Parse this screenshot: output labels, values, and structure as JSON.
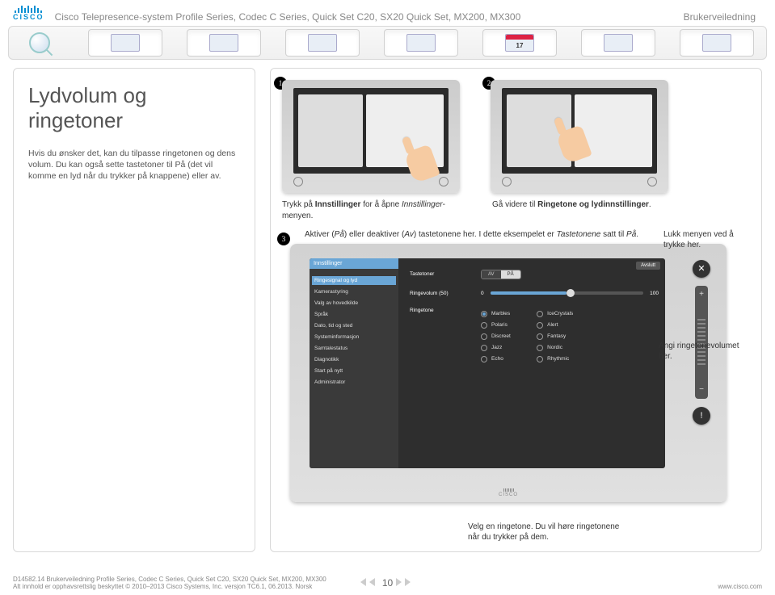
{
  "header": {
    "brand": "CISCO",
    "product_line": "Cisco Telepresence-system Profile Series, Codec C Series, Quick Set C20, SX20 Quick Set, MX200, MX300",
    "guide_label": "Brukerveiledning"
  },
  "nav": {
    "calendar_day": "17"
  },
  "left": {
    "title": "Lydvolum og ringetoner",
    "para1": "Hvis du ønsker det, kan du tilpasse ringetonen og dens volum. Du kan også sette tastetoner til På (det vil komme en lyd når du trykker på knappene) eller av.",
    "em_pa": "På"
  },
  "steps": {
    "s1_a": "Trykk på ",
    "s1_b": "Innstillinger",
    "s1_c": " for å åpne ",
    "s1_d": "Innstillinger",
    "s1_e": "-menyen.",
    "s2_a": "Gå videre til ",
    "s2_b": "Ringetone og lydinnstillinger",
    "s2_c": ".",
    "s3_a": "Aktiver (",
    "s3_pa": "På",
    "s3_b": ") eller deaktiver (",
    "s3_av": "Av",
    "s3_c": ") tastetonene her. I dette eksempelet er ",
    "s3_d": "Tastetonene",
    "s3_e": " satt til ",
    "s3_f": "På",
    "s3_g": "."
  },
  "annotations": {
    "close_menu": "Lukk menyen ved å trykke her.",
    "set_volume": "Angi ringetonevolumet her.",
    "pick_ringtone": "Velg en ringetone. Du vil høre ringetonene når du trykker på dem."
  },
  "settings_panel": {
    "header": "Innstillinger",
    "active_item": "Ringesignal og lyd",
    "close_btn": "Avslutt",
    "menu": [
      "Ringesignal og lyd",
      "Kamerastyring",
      "Valg av hovedkilde",
      "Språk",
      "Dato, tid og sted",
      "Systeminformasjon",
      "Samtalestatus",
      "Diagnotikk",
      "Start på nytt",
      "Administrator"
    ],
    "keytones_label": "Tastetoner",
    "toggle_off": "AV",
    "toggle_on": "PÅ",
    "volume_label": "Ringevolum (50)",
    "volume_min": "0",
    "volume_max": "100",
    "ringtone_label": "Ringetone",
    "ringtones": [
      {
        "name": "Marbles",
        "selected": true
      },
      {
        "name": "IceCrystals",
        "selected": false
      },
      {
        "name": "Polaris",
        "selected": false
      },
      {
        "name": "Alert",
        "selected": false
      },
      {
        "name": "Discreet",
        "selected": false
      },
      {
        "name": "Fantasy",
        "selected": false
      },
      {
        "name": "Jazz",
        "selected": false
      },
      {
        "name": "Nordic",
        "selected": false
      },
      {
        "name": "Echo",
        "selected": false
      },
      {
        "name": "Rhythmic",
        "selected": false
      }
    ],
    "brand_foot": "CISCO"
  },
  "footer": {
    "line1": "D14582.14 Brukerveiledning Profile Series, Codec C Series, Quick Set C20, SX20 Quick Set, MX200, MX300",
    "line2": "Alt innhold er opphavsrettslig beskyttet © 2010–2013 Cisco Systems, Inc. versjon TC6.1, 06.2013. Norsk",
    "page": "10",
    "url": "www.cisco.com"
  }
}
